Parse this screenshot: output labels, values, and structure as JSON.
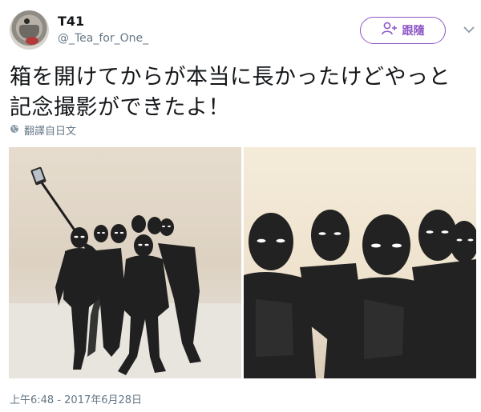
{
  "tweet": {
    "display_name": "T41",
    "handle": "@_Tea_for_One_",
    "follow_label": "跟隨",
    "text_line1": "箱を開けてからが本当に長かったけどやっと",
    "text_line2": "記念撮影ができたよ！",
    "translate_label": "翻譯自日文",
    "timestamp": "上午6:48 - 2017年6月28日"
  },
  "icons": {
    "avatar": "avatar-image",
    "follow": "add-user-icon",
    "more": "chevron-down-icon",
    "translate": "globe-icon"
  },
  "colors": {
    "accent": "#8e57c6",
    "muted": "#657786",
    "text": "#14171a"
  },
  "media": [
    {
      "name": "figures-selfie-photo"
    },
    {
      "name": "figures-closeup-photo"
    }
  ]
}
